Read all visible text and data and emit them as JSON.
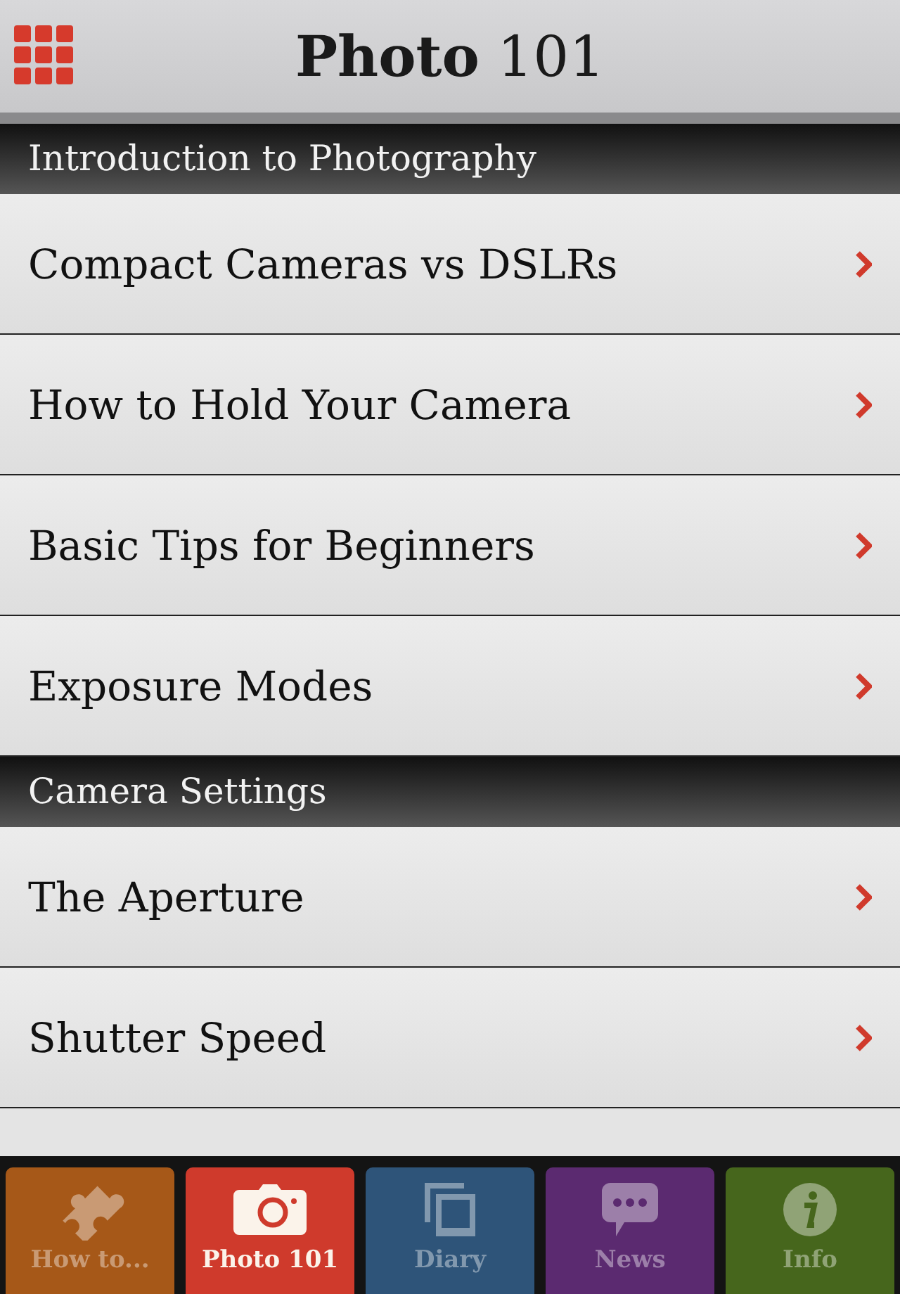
{
  "header": {
    "title": "**Photo** 101"
  },
  "sections": [
    {
      "title": "Introduction to Photography",
      "items": [
        "Compact Cameras vs DSLRs",
        "How to Hold Your Camera",
        "Basic Tips for Beginners",
        "Exposure Modes"
      ]
    },
    {
      "title": "Camera Settings",
      "items": [
        "The Aperture",
        "Shutter Speed"
      ]
    }
  ],
  "tabs": [
    {
      "label": "How to...",
      "kind": "puzzle",
      "color": "#a65818",
      "selected": false
    },
    {
      "label": "Photo 101",
      "kind": "camera",
      "color": "#cf3a2c",
      "selected": true
    },
    {
      "label": "Diary",
      "kind": "photos",
      "color": "#2e5479",
      "selected": false
    },
    {
      "label": "News",
      "kind": "chat",
      "color": "#5b2a70",
      "selected": false
    },
    {
      "label": "Info",
      "kind": "info",
      "color": "#46661c",
      "selected": false
    }
  ]
}
